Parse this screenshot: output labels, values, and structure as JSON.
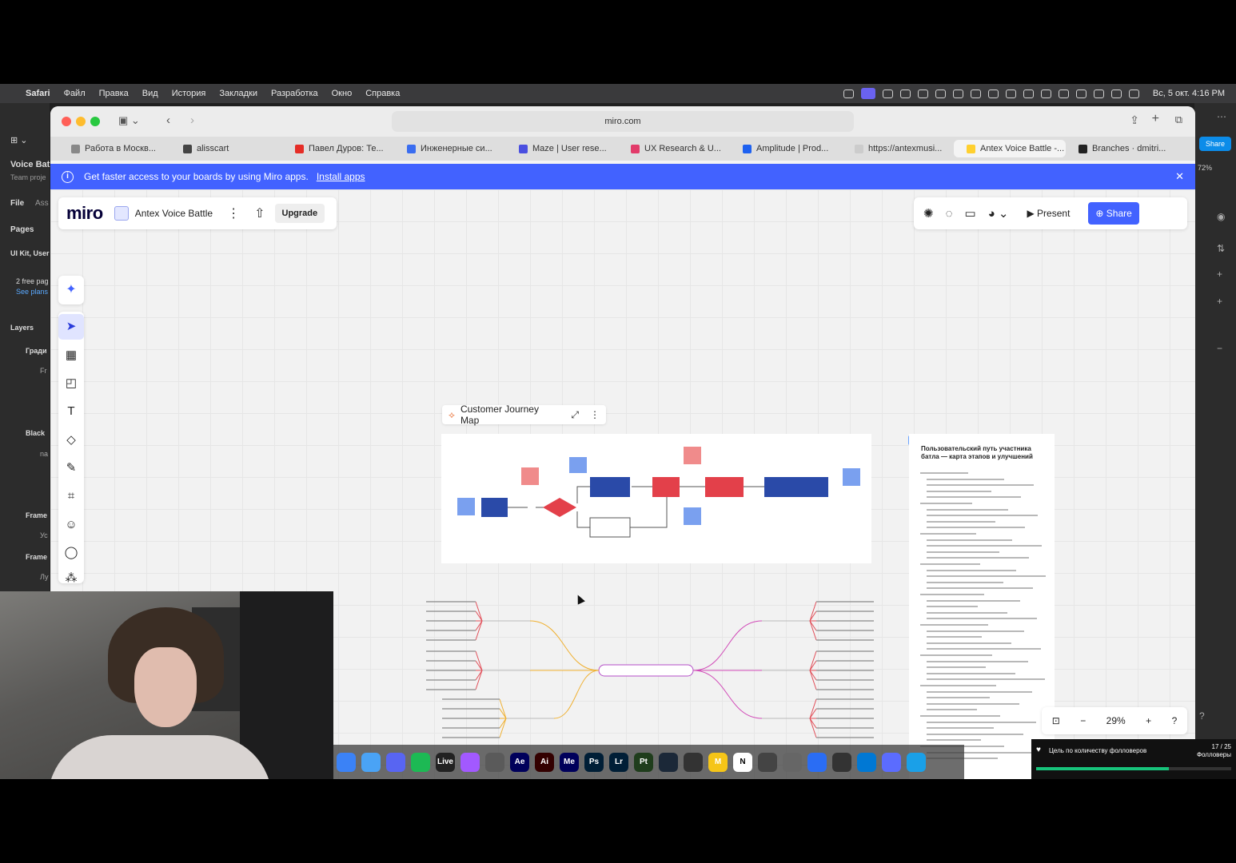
{
  "menubar": {
    "items": [
      "Safari",
      "Файл",
      "Правка",
      "Вид",
      "История",
      "Закладки",
      "Разработка",
      "Окно",
      "Справка"
    ],
    "clock": "Вс, 5 окт. 4:16 PM"
  },
  "figma": {
    "project_title": "Voice Bat",
    "project_sub": "Team proje",
    "file_tab": "File",
    "assets_tab": "Ass",
    "pages_label": "Pages",
    "page_item": "UI Kit, User",
    "free_pages": "2 free pag",
    "see_plans": "See plans",
    "layers_label": "Layers",
    "layers": [
      "Гради",
      "Fr",
      "Black",
      "na",
      "Frame",
      "Ус",
      "Frame",
      "Лу"
    ],
    "share_label": "Share",
    "zoom_label": "72%"
  },
  "safari": {
    "url": "miro.com",
    "tabs": [
      {
        "label": "Работа в Москв...",
        "color": "#888888"
      },
      {
        "label": "alisscart",
        "color": "#444444"
      },
      {
        "label": "Павел Дуров: Те...",
        "color": "#e52d27"
      },
      {
        "label": "Инженерные си...",
        "color": "#3a6df0"
      },
      {
        "label": "Maze | User rese...",
        "color": "#4a4fe0"
      },
      {
        "label": "UX Research & U...",
        "color": "#e23b6a"
      },
      {
        "label": "Amplitude | Prod...",
        "color": "#1e61f0"
      },
      {
        "label": "https://antexmusi...",
        "color": "#cccccc"
      },
      {
        "label": "Antex Voice Battle -...",
        "color": "#ffd02f"
      },
      {
        "label": "Branches · dmitri...",
        "color": "#222222"
      }
    ]
  },
  "banner": {
    "text": "Get faster access to your boards by using Miro apps.",
    "link": "Install apps"
  },
  "miro": {
    "logo": "miro",
    "board_name": "Antex Voice Battle",
    "upgrade": "Upgrade",
    "present": "Present",
    "share": "Share",
    "frame_title": "Customer Journey Map",
    "doc_title": "Пользовательский путь участника батла — карта этапов и улучшений",
    "zoom": "29%"
  },
  "dock": {
    "apps": [
      {
        "label": "",
        "color": "#3b82f6"
      },
      {
        "label": "",
        "color": "#4aa3f5"
      },
      {
        "label": "",
        "color": "#5865f2"
      },
      {
        "label": "",
        "color": "#1db954"
      },
      {
        "label": "Live",
        "color": "#222222"
      },
      {
        "label": "",
        "color": "#a259ff"
      },
      {
        "label": "",
        "color": "#5a5a5a"
      },
      {
        "label": "Ae",
        "color": "#00005b"
      },
      {
        "label": "Ai",
        "color": "#330000"
      },
      {
        "label": "Me",
        "color": "#00005b"
      },
      {
        "label": "Ps",
        "color": "#001e36"
      },
      {
        "label": "Lr",
        "color": "#001e36"
      },
      {
        "label": "Pt",
        "color": "#1f3d1c"
      },
      {
        "label": "",
        "color": "#1b2838"
      },
      {
        "label": "",
        "color": "#333333"
      },
      {
        "label": "M",
        "color": "#f5c518"
      },
      {
        "label": "N",
        "color": "#ffffff"
      },
      {
        "label": "",
        "color": "#444444"
      },
      {
        "label": "",
        "color": "#666666"
      },
      {
        "label": "",
        "color": "#2a6df4"
      },
      {
        "label": "",
        "color": "#333333"
      },
      {
        "label": "",
        "color": "#0078d4"
      },
      {
        "label": "",
        "color": "#5b6cff"
      },
      {
        "label": "",
        "color": "#1aa0e8"
      }
    ]
  },
  "goal": {
    "title": "Цель по количеству фолловеров",
    "count": "17 / 25",
    "unit": "Фолловеры",
    "progress": 0.68
  }
}
